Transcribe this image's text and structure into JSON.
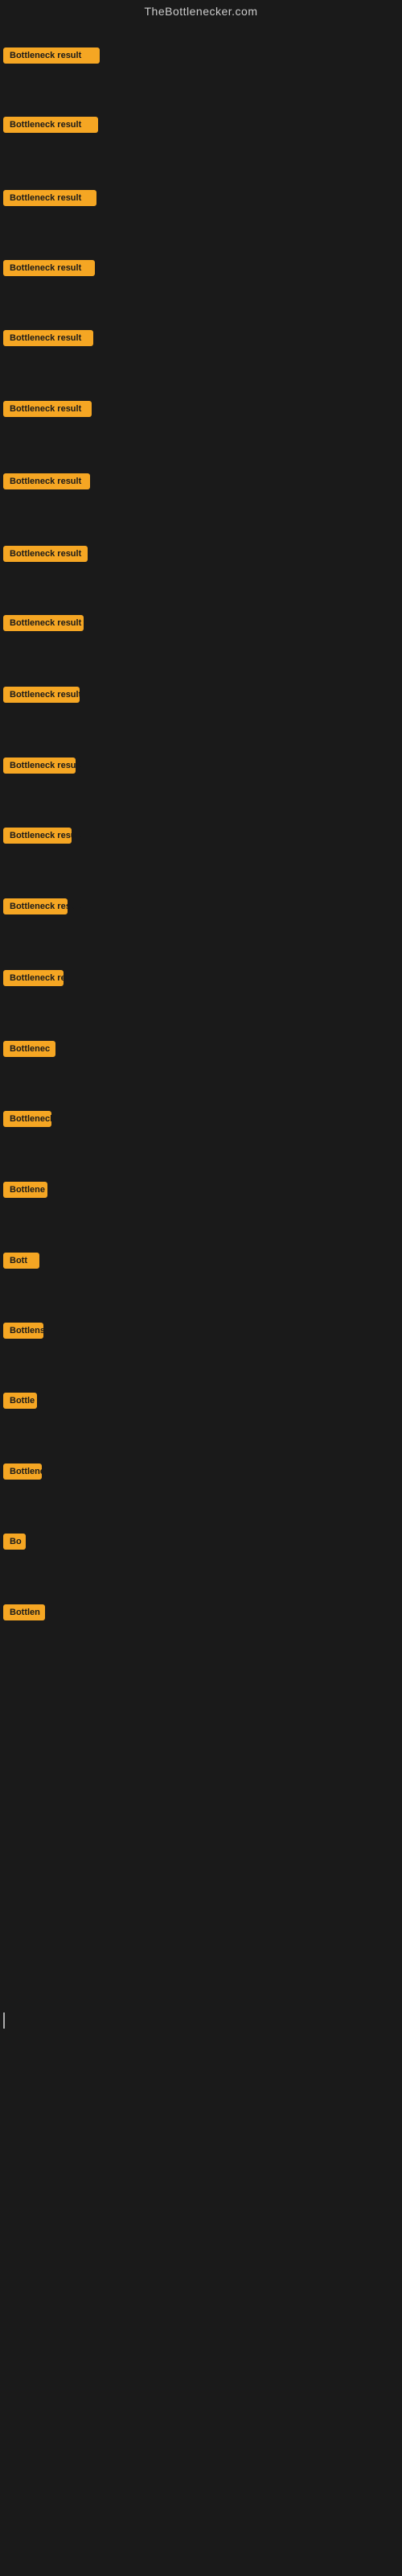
{
  "site": {
    "title": "TheBottlenecker.com"
  },
  "items": [
    {
      "id": 1,
      "label": "Bottleneck result",
      "widthClass": "badge-w1",
      "topOffset": 57
    },
    {
      "id": 2,
      "label": "Bottleneck result",
      "widthClass": "badge-w2",
      "topOffset": 143
    },
    {
      "id": 3,
      "label": "Bottleneck result",
      "widthClass": "badge-w3",
      "topOffset": 234
    },
    {
      "id": 4,
      "label": "Bottleneck result",
      "widthClass": "badge-w4",
      "topOffset": 321
    },
    {
      "id": 5,
      "label": "Bottleneck result",
      "widthClass": "badge-w5",
      "topOffset": 408
    },
    {
      "id": 6,
      "label": "Bottleneck result",
      "widthClass": "badge-w6",
      "topOffset": 496
    },
    {
      "id": 7,
      "label": "Bottleneck result",
      "widthClass": "badge-w7",
      "topOffset": 586
    },
    {
      "id": 8,
      "label": "Bottleneck result",
      "widthClass": "badge-w8",
      "topOffset": 676
    },
    {
      "id": 9,
      "label": "Bottleneck result",
      "widthClass": "badge-w9",
      "topOffset": 762
    },
    {
      "id": 10,
      "label": "Bottleneck result",
      "widthClass": "badge-w10",
      "topOffset": 851
    },
    {
      "id": 11,
      "label": "Bottleneck result",
      "widthClass": "badge-w11",
      "topOffset": 939
    },
    {
      "id": 12,
      "label": "Bottleneck result",
      "widthClass": "badge-w12",
      "topOffset": 1026
    },
    {
      "id": 13,
      "label": "Bottleneck result",
      "widthClass": "badge-w13",
      "topOffset": 1114
    },
    {
      "id": 14,
      "label": "Bottleneck res",
      "widthClass": "badge-w14",
      "topOffset": 1203
    },
    {
      "id": 15,
      "label": "Bottlenec",
      "widthClass": "badge-w15",
      "topOffset": 1291
    },
    {
      "id": 16,
      "label": "Bottleneck r",
      "widthClass": "badge-w16",
      "topOffset": 1378
    },
    {
      "id": 17,
      "label": "Bottlene",
      "widthClass": "badge-w17",
      "topOffset": 1466
    },
    {
      "id": 18,
      "label": "Bott",
      "widthClass": "badge-w18",
      "topOffset": 1554
    },
    {
      "id": 19,
      "label": "Bottlens",
      "widthClass": "badge-w19",
      "topOffset": 1641
    },
    {
      "id": 20,
      "label": "Bottle",
      "widthClass": "badge-w20",
      "topOffset": 1728
    },
    {
      "id": 21,
      "label": "Bottleneck",
      "widthClass": "badge-w21",
      "topOffset": 1816
    },
    {
      "id": 22,
      "label": "Bo",
      "widthClass": "badge-w22",
      "topOffset": 1903
    },
    {
      "id": 23,
      "label": "Bottlen",
      "widthClass": "badge-w23",
      "topOffset": 1991
    }
  ]
}
